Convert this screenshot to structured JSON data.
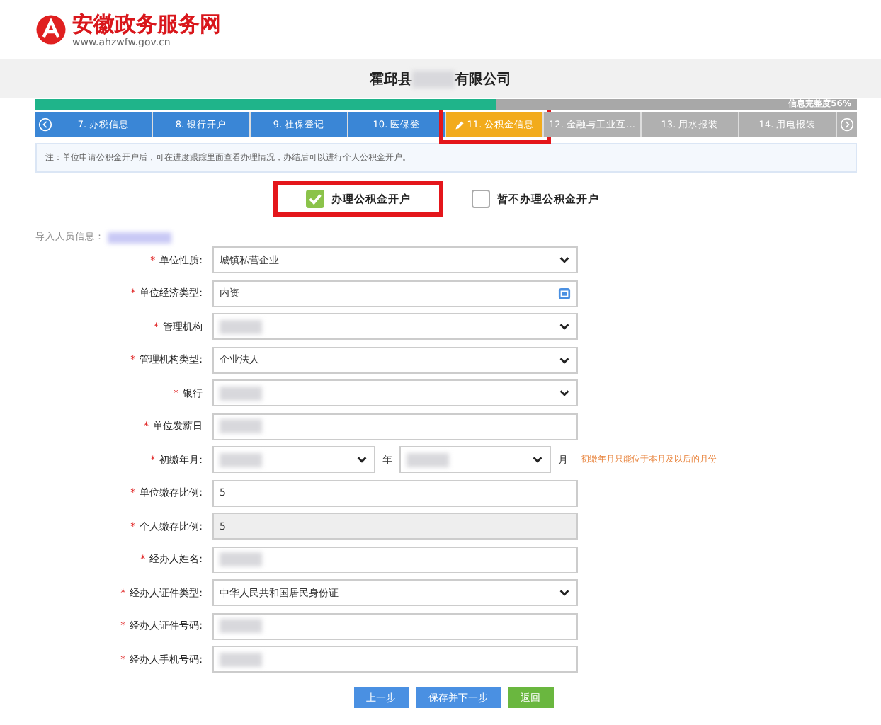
{
  "logo": {
    "name": "安徽政务服务网",
    "url": "www.ahzwfw.gov.cn"
  },
  "company": {
    "title_start": "霍邱县",
    "redacted": true,
    "title_end": "有限公司"
  },
  "progress": {
    "level": 0.56,
    "label": "信息完整度56%"
  },
  "steps": [
    {
      "label": "7. 办税信息",
      "completed": true,
      "selected": false,
      "highlighted": false
    },
    {
      "label": "8. 银行开户",
      "completed": true,
      "selected": false,
      "highlighted": false
    },
    {
      "label": "9. 社保登记",
      "completed": true,
      "selected": false,
      "highlighted": false
    },
    {
      "label": "10. 医保登",
      "completed": true,
      "selected": false,
      "highlighted": false
    },
    {
      "label": "11. 公积金信息",
      "completed": false,
      "selected": true,
      "highlighted": true
    },
    {
      "label": "12. 金融与工业互…",
      "completed": false,
      "selected": false,
      "highlighted": false
    },
    {
      "label": "13. 用水报装",
      "completed": false,
      "selected": false,
      "highlighted": false
    },
    {
      "label": "14. 用电报装",
      "completed": false,
      "selected": false,
      "highlighted": false
    }
  ],
  "note": "注：单位申请公积金开户后，可在进度跟踪里面查看办理情况，办结后可以进行个人公积金开户。",
  "options": [
    {
      "label": "办理公积金开户",
      "checked": true,
      "highlighted": true
    },
    {
      "label": "暂不办理公积金开户",
      "checked": false
    }
  ],
  "import": {
    "label": "导入人员信息：",
    "redacted": true
  },
  "fields": [
    {
      "kind": "select",
      "required_mark": "*",
      "label": "单位性质:",
      "value": "城镇私营企业"
    },
    {
      "kind": "picker",
      "required_mark": "*",
      "label": "单位经济类型:",
      "value": "内资"
    },
    {
      "kind": "select",
      "required_mark": "*",
      "label": "管理机构",
      "redacted": true
    },
    {
      "kind": "select",
      "required_mark": "*",
      "label": "管理机构类型:",
      "value": "企业法人"
    },
    {
      "kind": "select",
      "required_mark": "*",
      "label": "银行",
      "redacted": true
    },
    {
      "kind": "input",
      "required_mark": "*",
      "label": "单位发薪日",
      "redacted": true
    },
    {
      "kind": "yearmonth",
      "required_mark": "*",
      "label": "初缴年月:",
      "year_unit": "年",
      "month_unit": "月",
      "hint": "初缴年月只能位于本月及以后的月份",
      "redacted": true
    },
    {
      "kind": "input",
      "required_mark": "*",
      "label": "单位缴存比例:",
      "value": "5"
    },
    {
      "kind": "readonly",
      "required_mark": "*",
      "label": "个人缴存比例:",
      "value": "5"
    },
    {
      "kind": "input",
      "required_mark": "*",
      "label": "经办人姓名:",
      "redacted": true
    },
    {
      "kind": "select",
      "required_mark": "*",
      "label": "经办人证件类型:",
      "value": "中华人民共和国居民身份证"
    },
    {
      "kind": "input",
      "required_mark": "*",
      "label": "经办人证件号码:",
      "redacted": true
    },
    {
      "kind": "input",
      "required_mark": "*",
      "label": "经办人手机号码:",
      "redacted": true
    }
  ],
  "buttons": [
    {
      "label": "上一步",
      "kind": "primary"
    },
    {
      "label": "保存并下一步",
      "kind": "primary"
    },
    {
      "label": "返回",
      "kind": "success"
    }
  ]
}
